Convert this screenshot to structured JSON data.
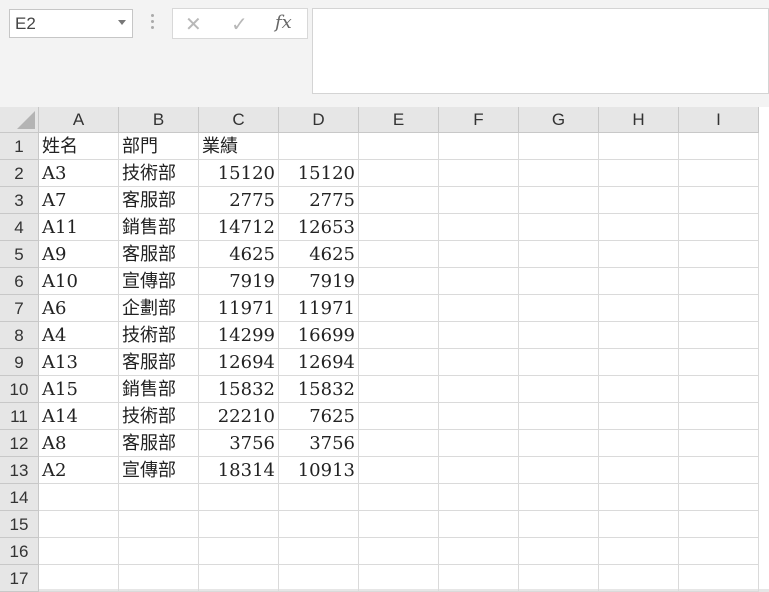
{
  "name_box": {
    "value": "E2"
  },
  "formula_bar": {
    "cancel_symbol": "✕",
    "enter_symbol": "✓",
    "function_symbol": "fx",
    "content": ""
  },
  "columns": [
    "A",
    "B",
    "C",
    "D",
    "E",
    "F",
    "G",
    "H",
    "I"
  ],
  "rows": [
    "1",
    "2",
    "3",
    "4",
    "5",
    "6",
    "7",
    "8",
    "9",
    "10",
    "11",
    "12",
    "13",
    "14",
    "15",
    "16",
    "17"
  ],
  "cells": [
    [
      "姓名",
      "部門",
      "業績",
      ""
    ],
    [
      "A3",
      "技術部",
      "15120",
      "15120"
    ],
    [
      "A7",
      "客服部",
      "2775",
      "2775"
    ],
    [
      "A11",
      "銷售部",
      "14712",
      "12653"
    ],
    [
      "A9",
      "客服部",
      "4625",
      "4625"
    ],
    [
      "A10",
      "宣傳部",
      "7919",
      "7919"
    ],
    [
      "A6",
      "企劃部",
      "11971",
      "11971"
    ],
    [
      "A4",
      "技術部",
      "14299",
      "16699"
    ],
    [
      "A13",
      "客服部",
      "12694",
      "12694"
    ],
    [
      "A15",
      "銷售部",
      "15832",
      "15832"
    ],
    [
      "A14",
      "技術部",
      "22210",
      "7625"
    ],
    [
      "A8",
      "客服部",
      "3756",
      "3756"
    ],
    [
      "A2",
      "宣傳部",
      "18314",
      "10913"
    ]
  ]
}
